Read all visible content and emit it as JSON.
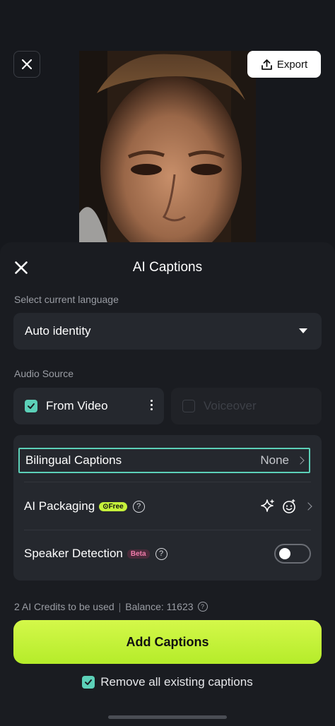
{
  "header": {
    "export_label": "Export",
    "icons": {
      "close": "close-icon",
      "export": "upload-icon"
    }
  },
  "sheet": {
    "title": "AI Captions",
    "language": {
      "label": "Select current language",
      "selected": "Auto identity"
    },
    "audio_source": {
      "label": "Audio Source",
      "from_video": {
        "label": "From Video",
        "checked": true
      },
      "voiceover": {
        "label": "Voiceover",
        "checked": false,
        "disabled": true
      }
    },
    "options": {
      "bilingual": {
        "label": "Bilingual Captions",
        "value": "None"
      },
      "packaging": {
        "label": "AI Packaging",
        "badge": "Free"
      },
      "speaker": {
        "label": "Speaker Detection",
        "badge": "Beta",
        "enabled": false
      }
    },
    "credits": {
      "used": "2 AI Credits to be used",
      "balance": "Balance: 11623"
    },
    "primary_button": "Add Captions",
    "remove_existing": {
      "label": "Remove all existing captions",
      "checked": true
    }
  },
  "colors": {
    "accent_teal": "#5cd0b8",
    "primary_green": "#c6f23b",
    "background": "#16181d",
    "card": "#25282e"
  }
}
